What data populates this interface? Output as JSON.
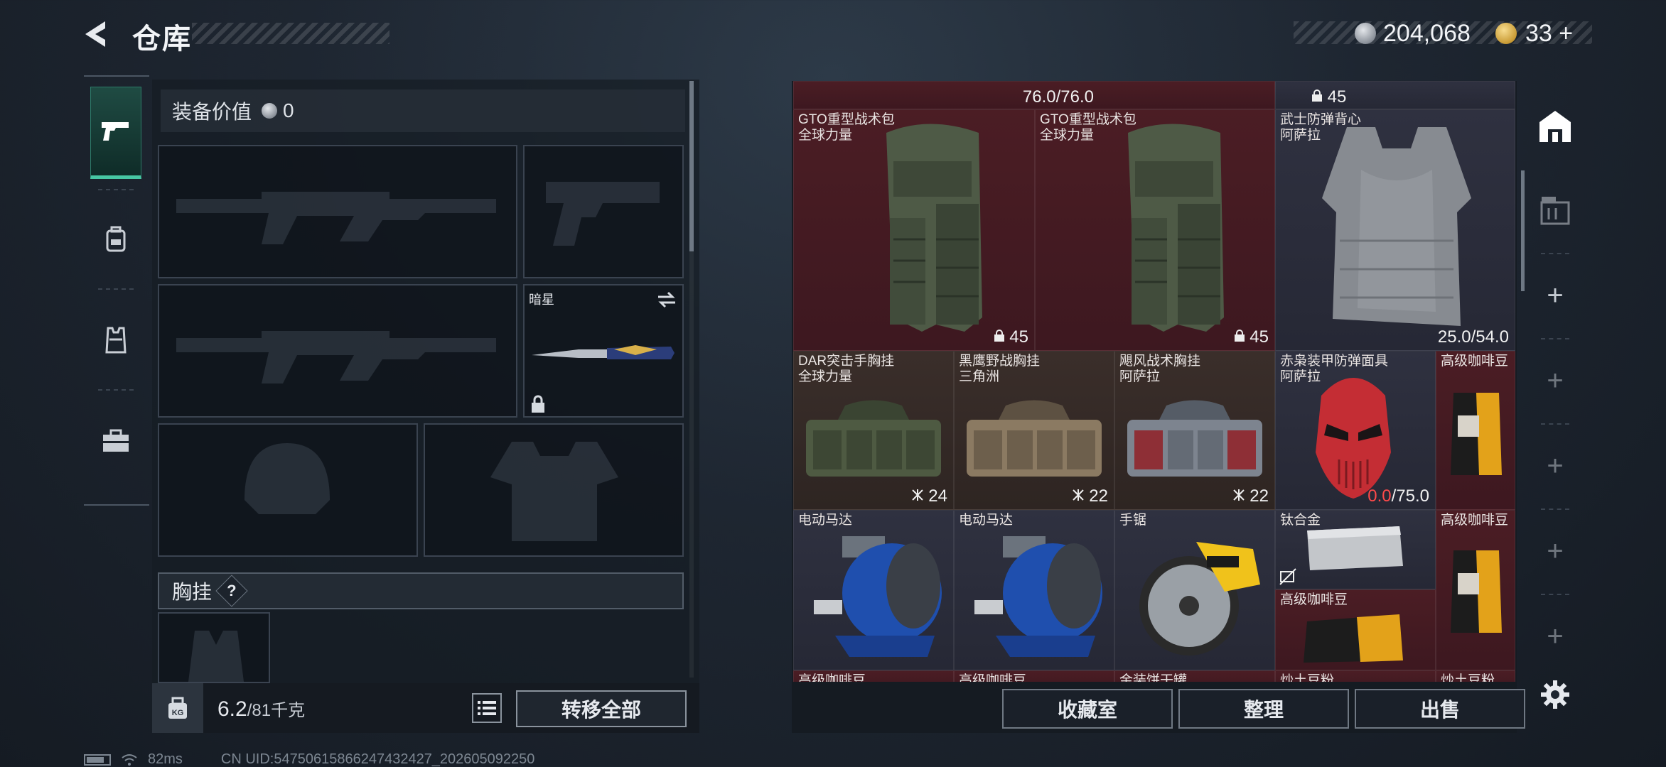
{
  "header": {
    "title": "仓库",
    "coins": "204,068",
    "tokens": "33",
    "tokens_plus": "+"
  },
  "left_tabs": [
    "weapon-tab",
    "backpack-tab",
    "armor-tab",
    "case-tab"
  ],
  "equipment": {
    "value_label": "装备价值",
    "value": "0",
    "melee_name": "暗星",
    "chest_label": "胸挂",
    "chest_help": "?",
    "weight_current": "6.2",
    "weight_max": "/81千克",
    "transfer_all": "转移全部"
  },
  "inventory": {
    "top_row": {
      "durability": "76.0/76.0",
      "count": "45"
    },
    "items": [
      {
        "name": "GTO重型战术包",
        "sub": "全球力量",
        "count": "45",
        "icon": "lock-icon"
      },
      {
        "name": "GTO重型战术包",
        "sub": "全球力量",
        "count": "45",
        "icon": "lock-icon"
      },
      {
        "name": "武士防弹背心",
        "sub": "阿萨拉",
        "durability": "25.0/54.0"
      },
      {
        "name": "DAR突击手胸挂",
        "sub": "全球力量",
        "count": "24",
        "icon": "grid-icon"
      },
      {
        "name": "黑鹰野战胸挂",
        "sub": "三角洲",
        "count": "22",
        "icon": "grid-icon"
      },
      {
        "name": "飓风战术胸挂",
        "sub": "阿萨拉",
        "count": "22",
        "icon": "grid-icon"
      },
      {
        "name": "赤枭装甲防弹面具",
        "sub": "阿萨拉",
        "durability_current": "0.0",
        "durability_max": "/75.0"
      },
      {
        "name": "高级咖啡豆",
        "sub": ""
      },
      {
        "name": "电动马达",
        "sub": ""
      },
      {
        "name": "电动马达",
        "sub": ""
      },
      {
        "name": "手锯",
        "sub": ""
      },
      {
        "name": "钛合金",
        "sub": ""
      },
      {
        "name": "高级咖啡豆",
        "sub": ""
      },
      {
        "name": "高级咖啡豆",
        "sub": ""
      }
    ],
    "bottom_partial": [
      "高级咖啡豆",
      "高级咖啡豆",
      "金装饼干罐",
      "炒土豆粉",
      "炒土豆粉"
    ]
  },
  "actions": {
    "collection": "收藏室",
    "organize": "整理",
    "sell": "出售"
  },
  "status": {
    "ping": "82ms",
    "uid": "CN UID:547506158662474324​27_202605092250"
  },
  "colors": {
    "accent": "#47c7a3",
    "red_cell": "#4b1d24",
    "gray_cell": "#2f3140",
    "durability_low": "#ff4a4a"
  }
}
